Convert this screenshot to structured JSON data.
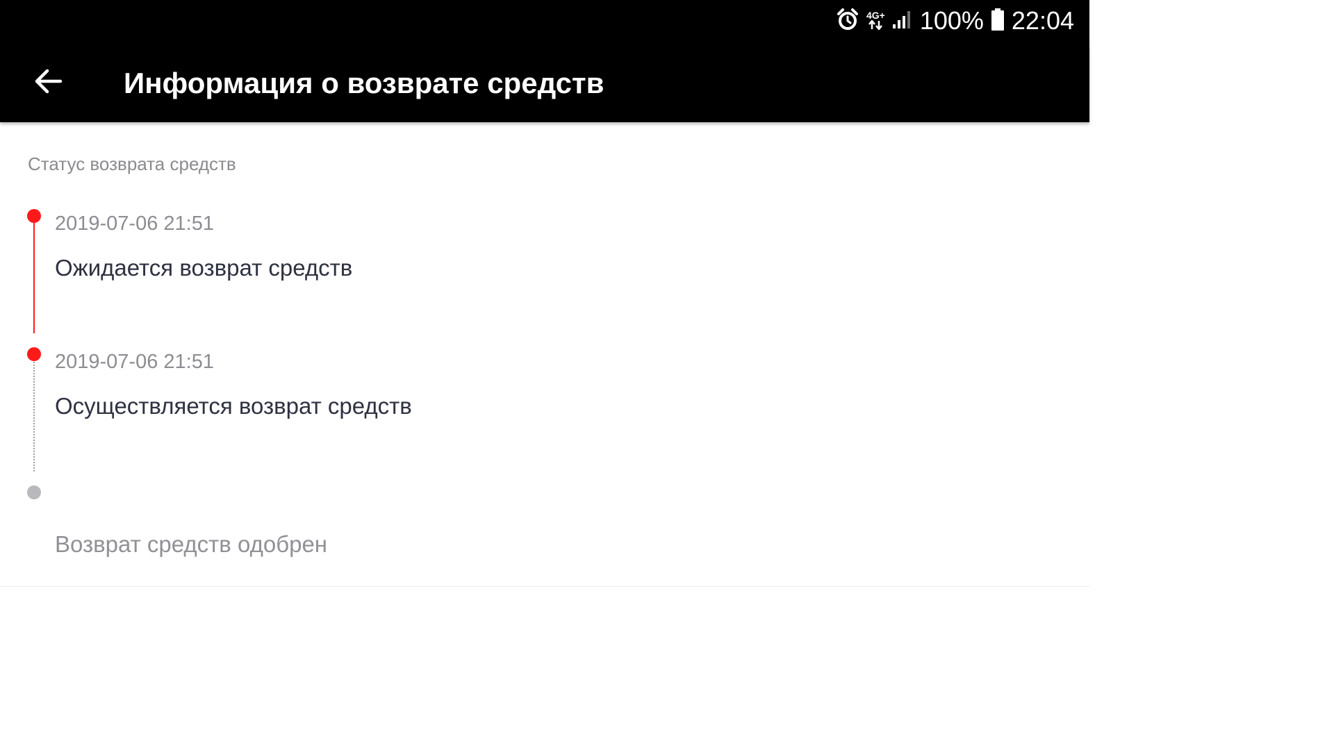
{
  "status_bar": {
    "network": "4G+",
    "battery_percent": "100%",
    "time": "22:04",
    "icons": [
      "alarm-icon",
      "data-arrows-icon",
      "signal-icon",
      "battery-icon"
    ]
  },
  "app_bar": {
    "title": "Информация о возврате средств",
    "back_icon": "arrow-left-icon"
  },
  "section": {
    "label": "Статус возврата средств"
  },
  "timeline": [
    {
      "timestamp": "2019-07-06 21:51",
      "status": "Ожидается возврат средств",
      "state": "active"
    },
    {
      "timestamp": "2019-07-06 21:51",
      "status": "Осуществляется возврат средств",
      "state": "active"
    },
    {
      "timestamp": "",
      "status": "Возврат средств одобрен",
      "state": "pending"
    }
  ],
  "colors": {
    "accent_red": "#ff1a1a",
    "pending_grey": "#b9b9bd",
    "header_bg": "#000000"
  }
}
